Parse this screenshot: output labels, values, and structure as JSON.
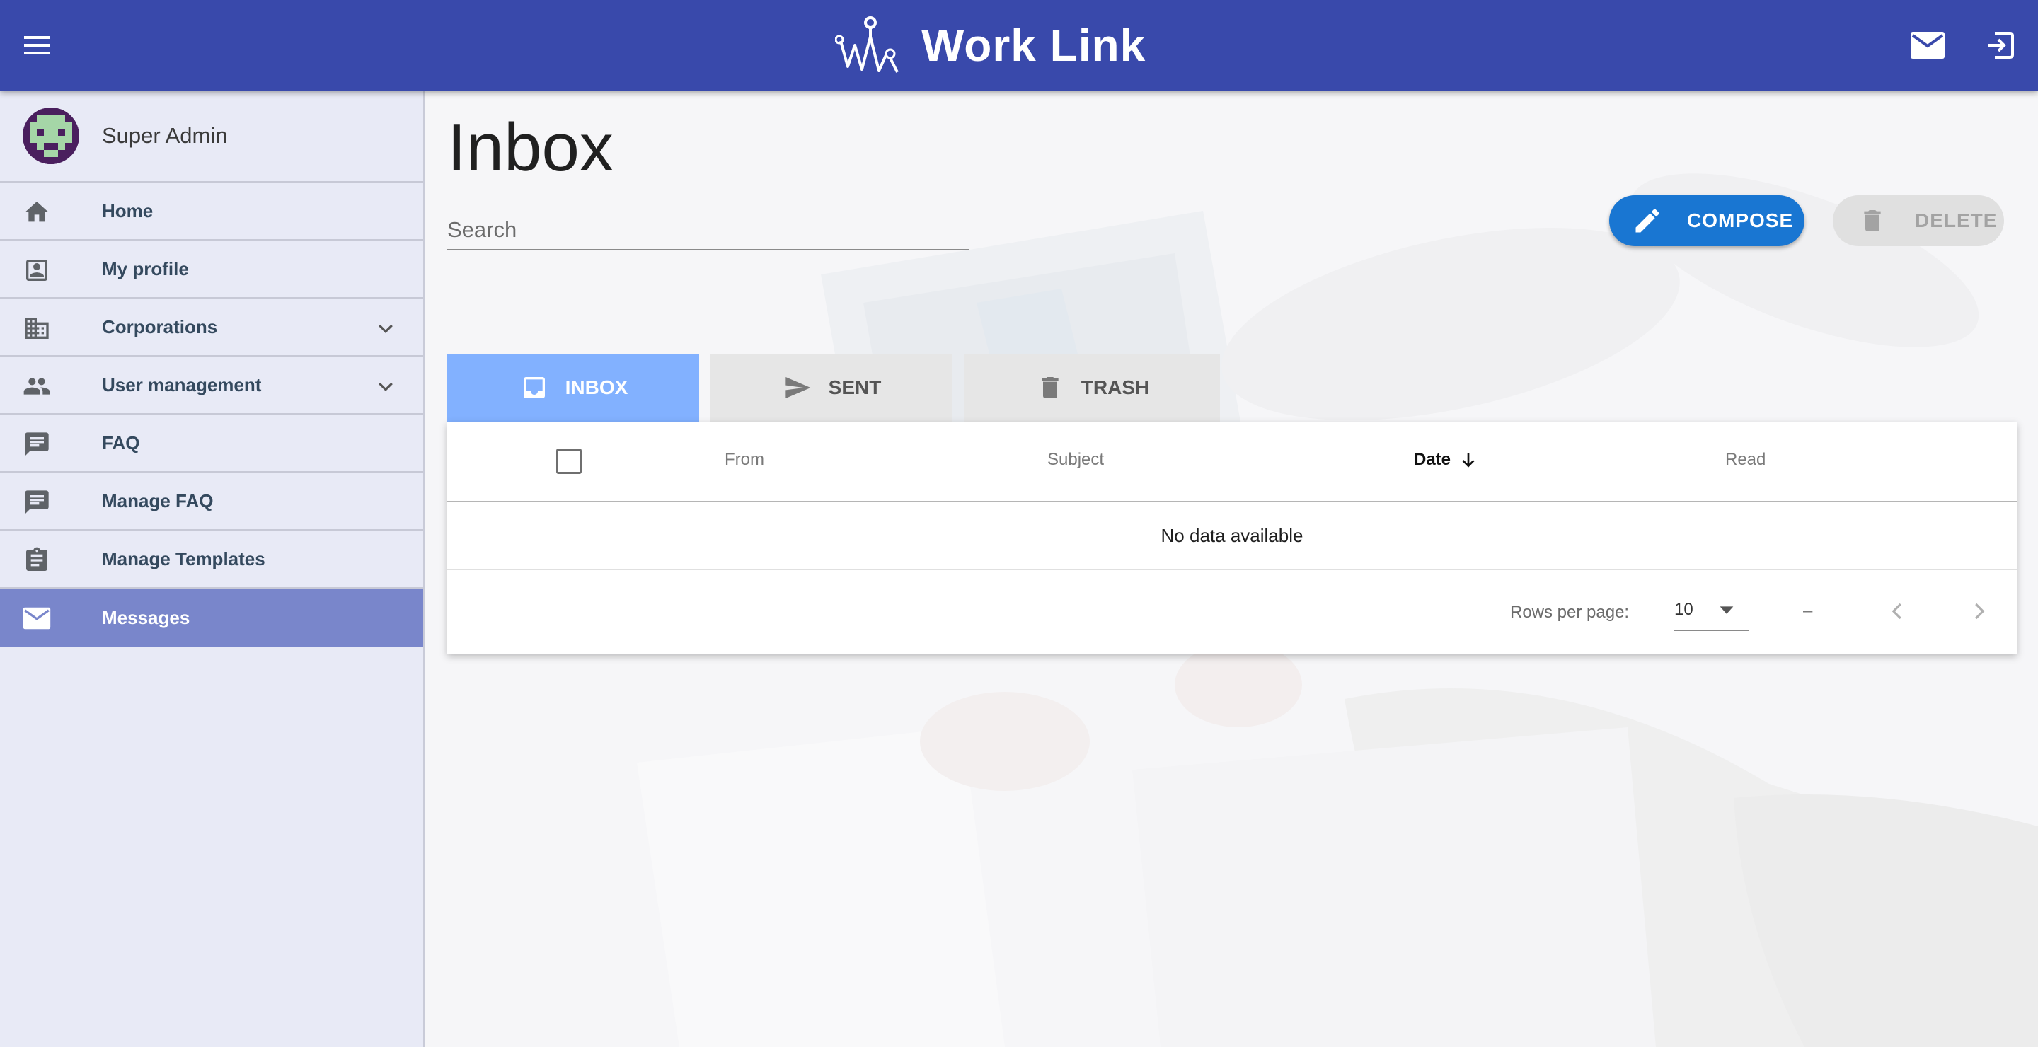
{
  "app": {
    "title": "Work Link",
    "brand_color": "#3949ab"
  },
  "header": {
    "menu_icon": "menu-icon",
    "mail_icon": "mail-icon",
    "logout_icon": "logout-icon"
  },
  "sidebar": {
    "user": {
      "name": "Super Admin",
      "avatar_icon": "pixel-avatar-icon"
    },
    "items": [
      {
        "label": "Home",
        "icon": "home-icon",
        "expandable": false,
        "active": false
      },
      {
        "label": "My profile",
        "icon": "profile-icon",
        "expandable": false,
        "active": false
      },
      {
        "label": "Corporations",
        "icon": "building-icon",
        "expandable": true,
        "active": false
      },
      {
        "label": "User management",
        "icon": "people-icon",
        "expandable": true,
        "active": false
      },
      {
        "label": "FAQ",
        "icon": "chat-icon",
        "expandable": false,
        "active": false
      },
      {
        "label": "Manage FAQ",
        "icon": "chat-icon",
        "expandable": false,
        "active": false
      },
      {
        "label": "Manage Templates",
        "icon": "clipboard-icon",
        "expandable": false,
        "active": false
      },
      {
        "label": "Messages",
        "icon": "mail-icon",
        "expandable": false,
        "active": true
      }
    ],
    "active_color": "#7986cb"
  },
  "main": {
    "title": "Inbox",
    "search": {
      "placeholder": "Search",
      "value": ""
    },
    "actions": {
      "compose_label": "COMPOSE",
      "compose_color": "#1976d2",
      "delete_label": "DELETE",
      "delete_enabled": false
    },
    "tabs": [
      {
        "label": "INBOX",
        "icon": "inbox-icon",
        "active": true
      },
      {
        "label": "SENT",
        "icon": "send-icon",
        "active": false
      },
      {
        "label": "TRASH",
        "icon": "trash-icon",
        "active": false
      }
    ],
    "tab_active_color": "#82b1ff",
    "table": {
      "columns": [
        "From",
        "Subject",
        "Date",
        "Read"
      ],
      "sorted_column": "Date",
      "sort_direction": "descending",
      "rows": [],
      "empty_text": "No data available",
      "footer": {
        "rows_per_page_label": "Rows per page:",
        "rows_per_page_value": "10",
        "range_text": "–"
      }
    }
  }
}
